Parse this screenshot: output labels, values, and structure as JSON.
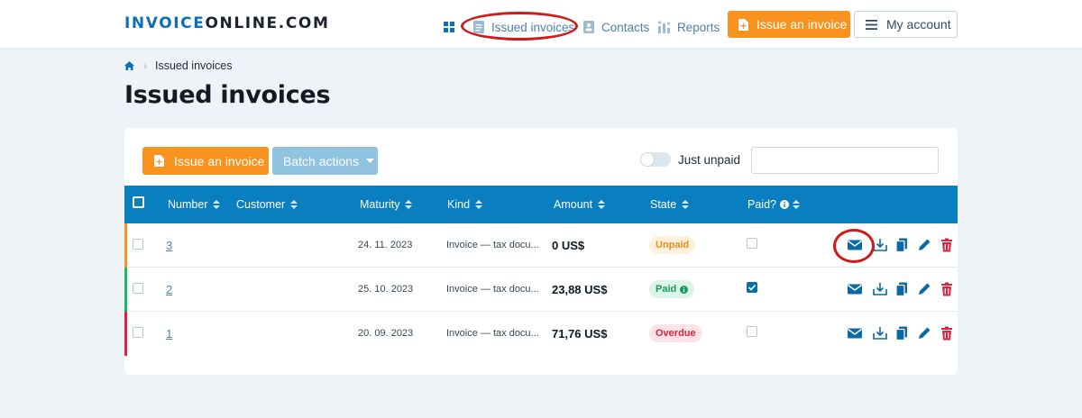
{
  "header": {
    "logo_part1": "INVOICE",
    "logo_part2": "ONLINE.COM",
    "nav": {
      "dashboard_icon": "grid-icon",
      "issued": "Issued invoices",
      "contacts": "Contacts",
      "reports": "Reports"
    },
    "issue_button": "Issue an invoice",
    "account_button": "My account"
  },
  "breadcrumb": {
    "home_icon": "home-icon",
    "current": "Issued invoices"
  },
  "page_title": "Issued invoices",
  "toolbar": {
    "issue_button": "Issue an invoice",
    "batch_button": "Batch actions",
    "toggle_label": "Just unpaid",
    "search_placeholder": ""
  },
  "table": {
    "headers": {
      "number": "Number",
      "customer": "Customer",
      "maturity": "Maturity",
      "kind": "Kind",
      "amount": "Amount",
      "state": "State",
      "paid": "Paid?"
    },
    "rows": [
      {
        "number": "3",
        "customer": "",
        "maturity": "24. 11. 2023",
        "kind": "Invoice — tax docu...",
        "amount": "0 US$",
        "state": "Unpaid",
        "paid": false,
        "color": "#f7931e"
      },
      {
        "number": "2",
        "customer": "",
        "maturity": "25. 10. 2023",
        "kind": "Invoice — tax docu...",
        "amount": "23,88 US$",
        "state": "Paid",
        "paid": true,
        "color": "#1fb86a"
      },
      {
        "number": "1",
        "customer": "",
        "maturity": "20. 09. 2023",
        "kind": "Invoice — tax docu...",
        "amount": "71,76 US$",
        "state": "Overdue",
        "paid": false,
        "color": "#d7263d"
      }
    ]
  },
  "colors": {
    "accent": "#0a7fc0",
    "orange": "#f7931e",
    "annotation": "#d01a1a"
  }
}
